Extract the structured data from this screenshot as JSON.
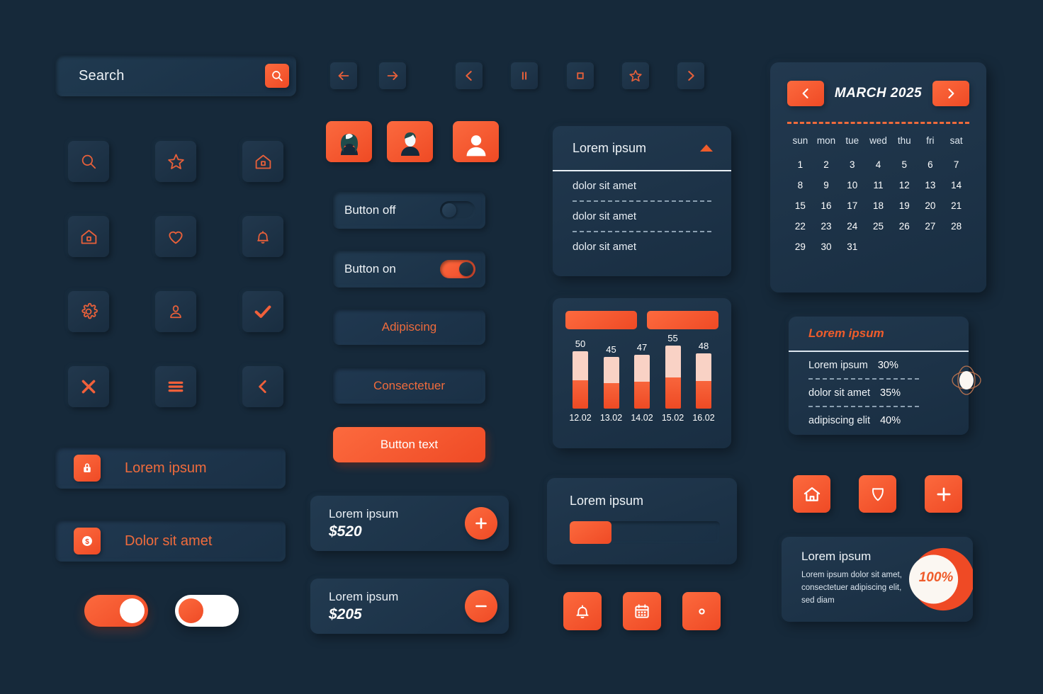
{
  "theme": {
    "background": "#16293a",
    "panel": "#21384e",
    "accent": "#ef4a25",
    "accent_light": "#fc6a3e",
    "text_light": "#eef3f7",
    "bar_light": "#f9d2c5"
  },
  "search": {
    "value": "Search",
    "icon": "search-icon"
  },
  "icon_grid": [
    {
      "name": "search-icon"
    },
    {
      "name": "star-icon"
    },
    {
      "name": "home-roof-icon"
    },
    {
      "name": "home-icon"
    },
    {
      "name": "heart-icon"
    },
    {
      "name": "bell-icon"
    },
    {
      "name": "gear-icon"
    },
    {
      "name": "user-icon"
    },
    {
      "name": "check-icon"
    },
    {
      "name": "close-icon"
    },
    {
      "name": "menu-icon"
    },
    {
      "name": "chevron-left-icon"
    }
  ],
  "nav_buttons": [
    {
      "name": "arrow-left-icon"
    },
    {
      "name": "arrow-right-icon"
    },
    {
      "name": "chevron-left-icon"
    },
    {
      "name": "pause-icon"
    },
    {
      "name": "stop-icon"
    },
    {
      "name": "star-icon"
    },
    {
      "name": "chevron-right-icon"
    }
  ],
  "avatars": [
    {
      "name": "avatar-female"
    },
    {
      "name": "avatar-male"
    },
    {
      "name": "avatar-generic"
    }
  ],
  "toggles": [
    {
      "label": "Button off",
      "state": "off"
    },
    {
      "label": "Button on",
      "state": "on"
    }
  ],
  "text_buttons": [
    {
      "label": "Adipiscing",
      "style": "ghost"
    },
    {
      "label": "Consectetuer",
      "style": "ghost"
    },
    {
      "label": "Button text",
      "style": "solid"
    }
  ],
  "wide_buttons": [
    {
      "label": "Lorem ipsum",
      "icon": "lock-icon"
    },
    {
      "label": "Dolor sit amet",
      "icon": "dollar-icon"
    }
  ],
  "pill_toggles": [
    {
      "state": "on",
      "style": "orange"
    },
    {
      "state": "off",
      "style": "white"
    }
  ],
  "price_cards": [
    {
      "name": "Lorem ipsum",
      "amount": "$520",
      "action": "plus-icon"
    },
    {
      "name": "Lorem ipsum",
      "amount": "$205",
      "action": "minus-icon"
    }
  ],
  "accordion": {
    "title": "Lorem ipsum",
    "chevron": "caret-up-icon",
    "items": [
      "dolor sit amet",
      "dolor sit amet",
      "dolor sit amet"
    ]
  },
  "chart_data": {
    "type": "bar",
    "title": "",
    "categories": [
      "12.02",
      "13.02",
      "14.02",
      "15.02",
      "16.02"
    ],
    "values": [
      50,
      45,
      47,
      55,
      48
    ],
    "series": [
      {
        "name": "legend-bar-1",
        "values": [
          50,
          45,
          47,
          55,
          48
        ]
      }
    ],
    "xlabel": "",
    "ylabel": "",
    "ylim": [
      0,
      60
    ],
    "grid": false,
    "legend_position": "top",
    "legend_entries": [
      "",
      ""
    ],
    "bar_split_ratio": 0.5,
    "colors": {
      "upper": "#f9d2c5",
      "lower": "#ef4a25"
    }
  },
  "progress_card": {
    "title": "Lorem ipsum",
    "percent": 28
  },
  "bottom_icon_buttons": [
    {
      "name": "bell-icon"
    },
    {
      "name": "calendar-icon"
    },
    {
      "name": "gear-icon"
    }
  ],
  "calendar": {
    "title": "MARCH 2025",
    "prev": "chevron-left-icon",
    "next": "chevron-right-icon",
    "dow": [
      "sun",
      "mon",
      "tue",
      "wed",
      "thu",
      "fri",
      "sat"
    ],
    "days": [
      "1",
      "2",
      "3",
      "4",
      "5",
      "6",
      "7",
      "8",
      "9",
      "10",
      "11",
      "12",
      "13",
      "14",
      "15",
      "16",
      "17",
      "18",
      "19",
      "20",
      "21",
      "22",
      "23",
      "24",
      "25",
      "26",
      "27",
      "28",
      "29",
      "30",
      "31",
      "",
      "",
      "",
      ""
    ]
  },
  "stats_card": {
    "title": "Lorem ipsum",
    "rows": [
      {
        "label": "Lorem ipsum",
        "value": "30%"
      },
      {
        "label": "dolor sit amet",
        "value": "35%"
      },
      {
        "label": "adipiscing elit",
        "value": "40%"
      }
    ]
  },
  "right_icon_buttons": [
    {
      "name": "home-icon"
    },
    {
      "name": "shield-icon"
    },
    {
      "name": "plus-icon"
    }
  ],
  "donut_card": {
    "title": "Lorem ipsum",
    "description": "Lorem ipsum dolor sit amet,\nconsectetuer adipiscing elit,\nsed diam",
    "percent_label": "100%",
    "percent": 100
  }
}
